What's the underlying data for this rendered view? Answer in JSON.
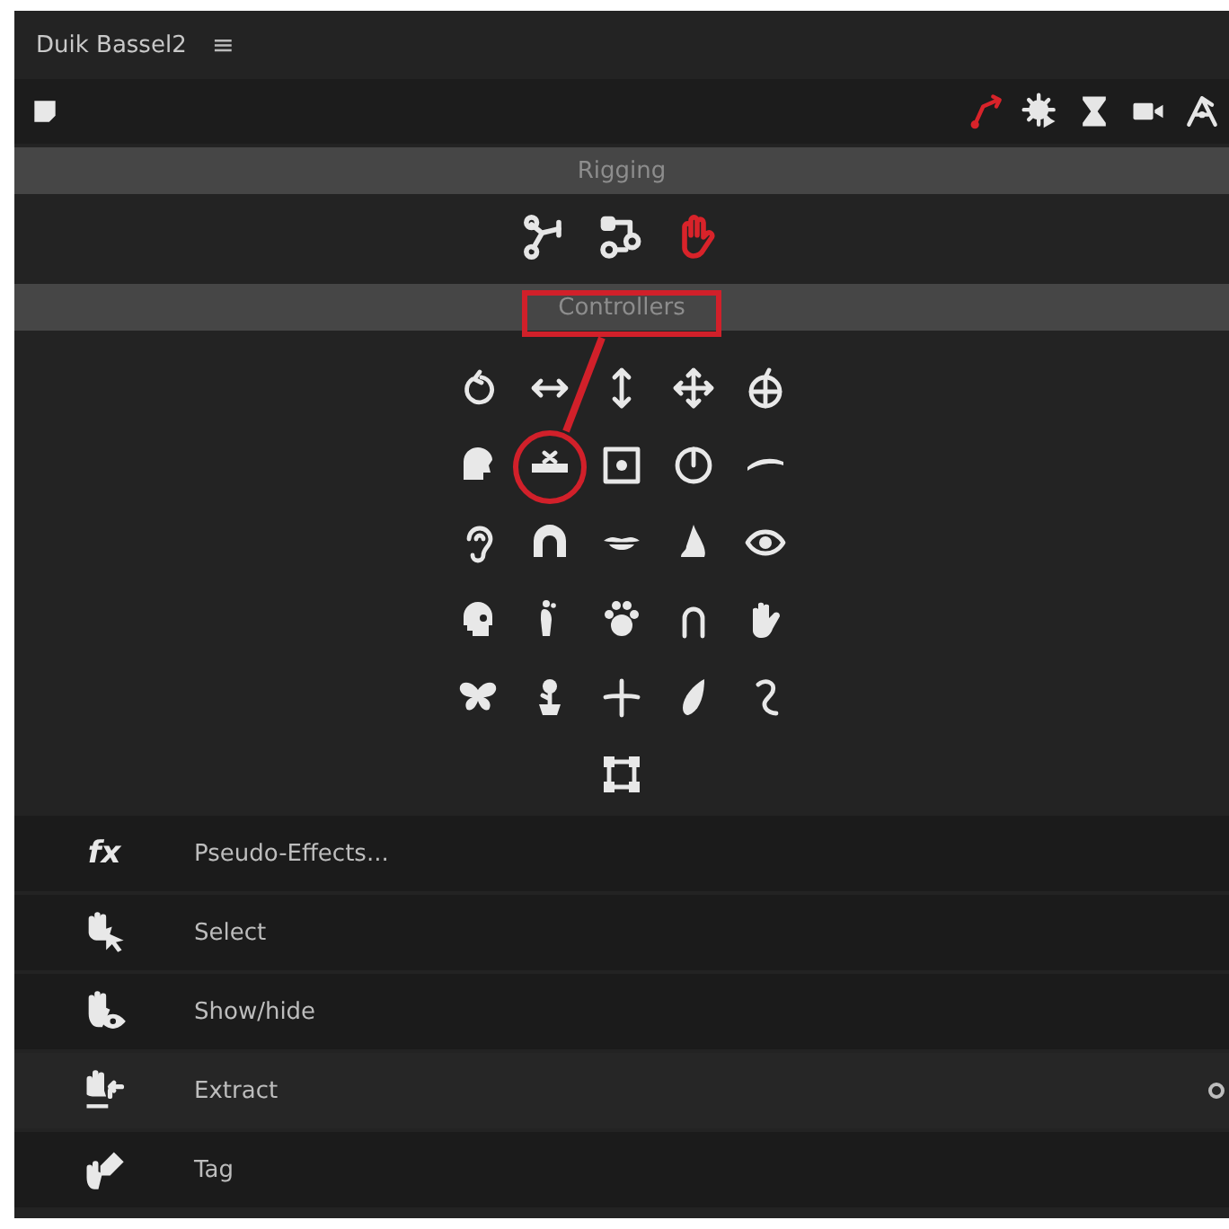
{
  "panel": {
    "title": "Duik Bassel2",
    "menu_glyph": "≡"
  },
  "toolbar": {
    "tools": [
      {
        "selected": true
      },
      {
        "selected": false
      },
      {
        "selected": false
      },
      {
        "selected": false
      },
      {
        "selected": false
      }
    ]
  },
  "rigging": {
    "title": "Rigging",
    "tools": [
      {
        "selected": false
      },
      {
        "selected": false
      },
      {
        "selected": true
      }
    ]
  },
  "controllers": {
    "title": "Controllers"
  },
  "actions": [
    {
      "icon_text": "fx",
      "label": "Pseudo-Effects...",
      "highlighted": false
    },
    {
      "label": "Select",
      "highlighted": false
    },
    {
      "label": "Show/hide",
      "highlighted": false
    },
    {
      "label": "Extract",
      "highlighted": true
    },
    {
      "label": "Tag",
      "highlighted": false
    }
  ]
}
